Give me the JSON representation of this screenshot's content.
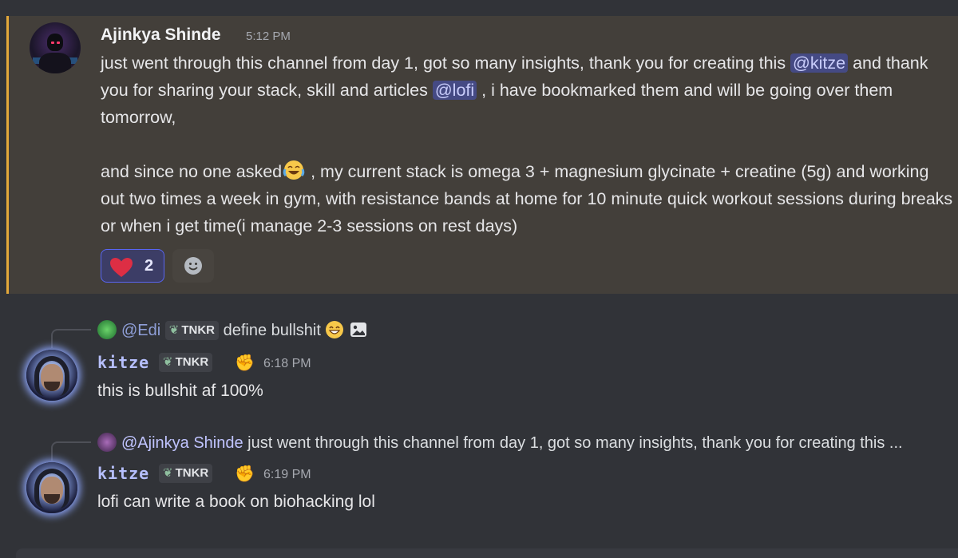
{
  "message1": {
    "author": "Ajinkya Shinde",
    "time": "5:12 PM",
    "line1_pre": "just went through this channel from day 1, got so many insights, thank you for creating this ",
    "mention1": "@kitze",
    "line2_pre": "and thank you for sharing your stack, skill and articles ",
    "mention2": "@lofi",
    "line2_post": " , i have bookmarked them and will be going over them tomorrow,",
    "para2_pre": "and since no one asked",
    "para2_post": " , my current stack is omega 3 + magnesium glycinate + creatine (5g) and working out two times a week in gym, with resistance bands at home for 10 minute quick workout sessions during breaks or when i get time(i manage 2-3 sessions on rest days)",
    "reaction_count": "2"
  },
  "message2": {
    "reply_to_user": "@Edi",
    "reply_tag": "TNKR",
    "reply_text": "define bullshit",
    "author": "kitze",
    "tag": "TNKR",
    "time": "6:18 PM",
    "text": "this is bullshit af 100%"
  },
  "message3": {
    "reply_to_user": "@Ajinkya Shinde",
    "reply_text": "just went through this channel from day 1, got so many insights, thank you for creating this ...",
    "author": "kitze",
    "tag": "TNKR",
    "time": "6:19 PM",
    "text": "lofi can write a book on biohacking lol"
  },
  "icons": {
    "heart": "heart-emoji",
    "add_reaction": "smile-icon",
    "laugh": "joy-emoji",
    "grin": "grin-emoji",
    "image": "image-icon",
    "fist": "fist-emoji"
  },
  "colors": {
    "highlight_bg": "#433f3a",
    "highlight_border": "#e3a83a",
    "mention_bg": "#454a84",
    "kitze_name": "#b6bffd"
  }
}
